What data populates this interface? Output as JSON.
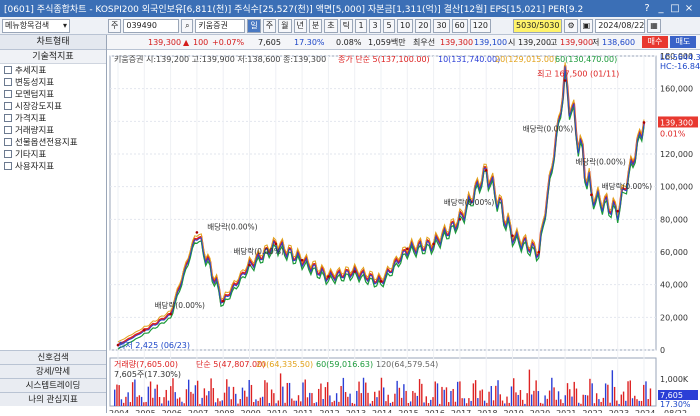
{
  "titlebar": {
    "text": "[0601] 주식종합차트 - KOSPI200 외국인보유[6,811(천)] 주식수[25,527(천)] 액면[5,000] 자본금[1,311(억)] 결산[12월] EPS[15,021] PER[9.2",
    "btns": [
      "?",
      "_",
      "□",
      "×"
    ]
  },
  "toolbar1": {
    "search": "메뉴항목검색",
    "code": "039490",
    "name": "키움증권",
    "periods": [
      "일",
      "주",
      "월",
      "년",
      "분",
      "초",
      "틱"
    ],
    "nums": [
      "1",
      "3",
      "5",
      "10",
      "20",
      "30",
      "60",
      "120"
    ],
    "count": "5030/5030",
    "date": "2024/08/22"
  },
  "toolbar2": {
    "price": "139,300",
    "chg": "100",
    "chg_pct": "+0.07%",
    "vol": "7,605",
    "vol_ratio": "17.30%",
    "turn": "0.08%",
    "amount": "1,059백만",
    "best": "최우선",
    "ask": "139,300",
    "bid": "139,100",
    "open_lbl": "시",
    "open": "139,200",
    "high_lbl": "고",
    "high": "139,900",
    "low_lbl": "저",
    "low": "138,600",
    "buy": "매수",
    "sell": "매도"
  },
  "sidebar": {
    "title": "차트형태",
    "sub": "기술적지표",
    "items": [
      "추세지표",
      "변동성지표",
      "모멘텀지표",
      "시장강도지표",
      "가격지표",
      "거래량지표",
      "선물옵션전용지표",
      "기타지표",
      "사용자지표"
    ],
    "bottom": [
      "신호검색",
      "강세/약세",
      "시스템트레이딩",
      "나의 관심지표"
    ]
  },
  "chart_data": {
    "type": "line",
    "title": "키움증권 시:139,200 고:139,900 저:138,600 종:139,300",
    "legend": [
      "종가 단순 5(137,100.00)",
      "10(131,740.00)",
      "20(129,015.00)",
      "60(130,470.00)"
    ],
    "x": [
      "2004",
      "2005",
      "2006",
      "2007",
      "2008",
      "2009",
      "2010",
      "2011",
      "2012",
      "2013",
      "2014",
      "2015",
      "2016",
      "2017",
      "2018",
      "2019",
      "2020",
      "2021",
      "2022",
      "2023",
      "2024"
    ],
    "series": [
      {
        "name": "종가",
        "values": [
          3000,
          12000,
          22000,
          72000,
          30000,
          52000,
          65000,
          55000,
          45000,
          48000,
          42000,
          62000,
          65000,
          80000,
          110000,
          70000,
          60000,
          165000,
          95000,
          85000,
          139300
        ]
      }
    ],
    "ylim": [
      0,
      180000
    ],
    "yticks": [
      "180,000",
      "160,000",
      "140,000",
      "120,000",
      "100,000",
      "80,000",
      "60,000",
      "40,000",
      "20,000",
      "0"
    ],
    "lc": "LC:5644.33",
    "hc": "HC:-16.84",
    "current": "139,300",
    "current_pct": "0.01%",
    "high_note": "최고 167,500 (01/11)",
    "low_note": "최저 2,425 (06/23)",
    "dividend": "배당락(0.00%)",
    "vol_title": "거래량(7,605.00)",
    "vol_ma": [
      "단순 5(47,807.00)",
      "20(64,335.50)",
      "60(59,016.63)",
      "120(64,579.54)"
    ],
    "vol_sub": "7,605주(17.30%)",
    "vol_yticks": [
      "1,000K",
      "500K"
    ],
    "vol_current": "7,605",
    "vol_pct": "17.30%",
    "last_date": "08/22"
  }
}
